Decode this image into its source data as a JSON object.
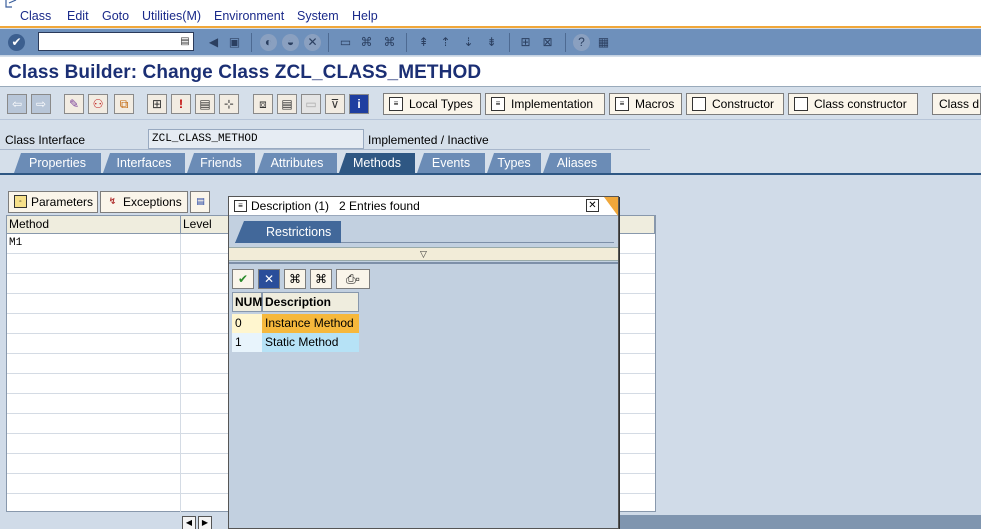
{
  "menubar": {
    "items": [
      "Class",
      "Edit",
      "Goto",
      "Utilities(M)",
      "Environment",
      "System",
      "Help"
    ]
  },
  "toolbar": {
    "command_field_value": "",
    "icons": [
      "enter-icon",
      "back-icon",
      "save-icon",
      "back-arrow-icon",
      "exit-icon",
      "cancel-icon",
      "print-icon",
      "find-icon",
      "find-next-icon",
      "first-page-icon",
      "previous-page-icon",
      "next-page-icon",
      "last-page-icon",
      "create-session-icon",
      "shortcut-icon",
      "help-icon",
      "layout-icon"
    ]
  },
  "title": "Class Builder: Change Class ZCL_CLASS_METHOD",
  "app_toolbar": {
    "buttons": [
      "Local Types",
      "Implementation",
      "Macros",
      "Constructor",
      "Class constructor",
      "Class d"
    ]
  },
  "class_interface": {
    "label": "Class Interface",
    "value": "ZCL_CLASS_METHOD",
    "status": "Implemented / Inactive"
  },
  "tabs": [
    "Properties",
    "Interfaces",
    "Friends",
    "Attributes",
    "Methods",
    "Events",
    "Types",
    "Aliases"
  ],
  "active_tab": "Methods",
  "grid_toolbar": {
    "parameters": "Parameters",
    "exceptions": "Exceptions"
  },
  "grid": {
    "columns": [
      "Method",
      "Level"
    ],
    "rows": [
      [
        "M1",
        ""
      ]
    ]
  },
  "popup": {
    "title": "Description (1)",
    "entries": "2 Entries found",
    "restrictions_tab": "Restrictions",
    "columns": [
      "NUM",
      "Description"
    ],
    "rows": [
      {
        "num": "0",
        "description": "Instance Method"
      },
      {
        "num": "1",
        "description": "Static Method"
      }
    ]
  }
}
